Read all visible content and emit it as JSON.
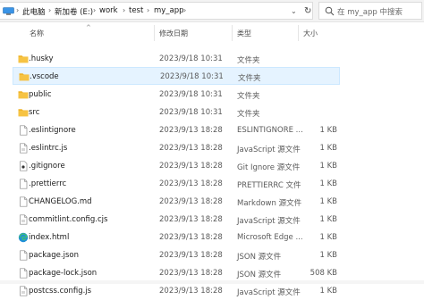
{
  "address": {
    "crumbs": [
      "此电脑",
      "新加卷 (E:)",
      "work",
      "test",
      "my_app"
    ],
    "search_placeholder": "在 my_app 中搜索"
  },
  "columns": {
    "name": "名称",
    "date": "修改日期",
    "type": "类型",
    "size": "大小"
  },
  "files": [
    {
      "name": ".husky",
      "date": "2023/9/18 10:31",
      "type": "文件夹",
      "size": "",
      "icon": "folder-icon"
    },
    {
      "name": ".vscode",
      "date": "2023/9/18 10:31",
      "type": "文件夹",
      "size": "",
      "icon": "folder-icon",
      "selected": true
    },
    {
      "name": "public",
      "date": "2023/9/18 10:31",
      "type": "文件夹",
      "size": "",
      "icon": "folder-icon"
    },
    {
      "name": "src",
      "date": "2023/9/18 10:31",
      "type": "文件夹",
      "size": "",
      "icon": "folder-icon"
    },
    {
      "name": ".eslintignore",
      "date": "2023/9/13 18:28",
      "type": "ESLINTIGNORE ...",
      "size": "1 KB",
      "icon": "file-icon"
    },
    {
      "name": ".eslintrc.js",
      "date": "2023/9/13 18:28",
      "type": "JavaScript 源文件",
      "size": "1 KB",
      "icon": "js-file-icon"
    },
    {
      "name": ".gitignore",
      "date": "2023/9/13 18:28",
      "type": "Git Ignore 源文件",
      "size": "1 KB",
      "icon": "git-file-icon"
    },
    {
      "name": ".prettierrc",
      "date": "2023/9/13 18:28",
      "type": "PRETTIERRC 文件",
      "size": "1 KB",
      "icon": "file-icon"
    },
    {
      "name": "CHANGELOG.md",
      "date": "2023/9/13 18:28",
      "type": "Markdown 源文件",
      "size": "1 KB",
      "icon": "file-icon"
    },
    {
      "name": "commitlint.config.cjs",
      "date": "2023/9/13 18:28",
      "type": "JavaScript 源文件",
      "size": "1 KB",
      "icon": "js-file-icon"
    },
    {
      "name": "index.html",
      "date": "2023/9/13 18:28",
      "type": "Microsoft Edge ...",
      "size": "1 KB",
      "icon": "edge-icon"
    },
    {
      "name": "package.json",
      "date": "2023/9/13 18:28",
      "type": "JSON 源文件",
      "size": "1 KB",
      "icon": "file-icon"
    },
    {
      "name": "package-lock.json",
      "date": "2023/9/13 18:28",
      "type": "JSON 源文件",
      "size": "508 KB",
      "icon": "file-icon"
    },
    {
      "name": "postcss.config.js",
      "date": "2023/9/13 18:28",
      "type": "JavaScript 源文件",
      "size": "1 KB",
      "icon": "js-file-icon"
    }
  ],
  "colors": {
    "selection": "#e5f3ff",
    "folder": "#f6c343"
  }
}
